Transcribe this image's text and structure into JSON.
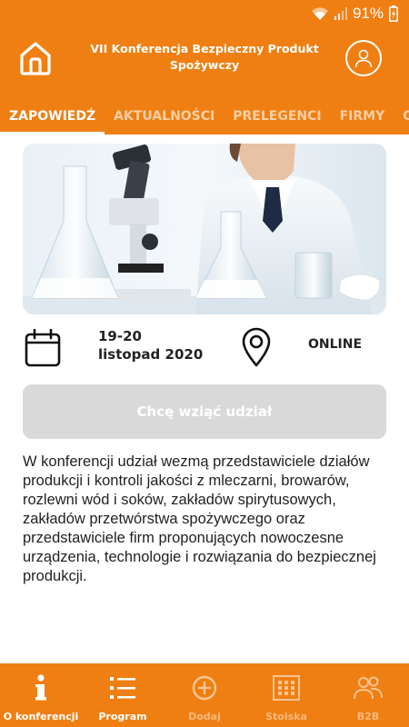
{
  "status_bar": {
    "battery": "91%"
  },
  "app_bar": {
    "title": "VII Konferencja Bezpieczny Produkt Spożywczy",
    "home_icon": "home-icon",
    "profile_icon": "user-icon"
  },
  "tabs": [
    {
      "label": "ZAPOWIEDŹ",
      "active": true
    },
    {
      "label": "AKTUALNOŚCI"
    },
    {
      "label": "PRELEGENCI"
    },
    {
      "label": "FIRMY"
    },
    {
      "label": "OFERTY"
    }
  ],
  "event": {
    "date_line1": "19-20",
    "date_line2": "listopad 2020",
    "location": "ONLINE"
  },
  "join_button": {
    "label": "Chcę wziąć udział",
    "enabled": false
  },
  "description": "W konferencji udział wezmą przedstawiciele działów produkcji i kontroli jakości z mleczarni, browarów, rozlewni wód i soków, zakładów spirytusowych, zakładów przetwórstwa spożywczego oraz przedstawiciele firm proponujących nowoczesne urządzenia, technologie i rozwiązania do bezpiecznej produkcji.",
  "bottom_nav": [
    {
      "label": "O konferencji",
      "icon": "info-icon",
      "enabled": true
    },
    {
      "label": "Program",
      "icon": "list-icon",
      "enabled": true
    },
    {
      "label": "Dodaj",
      "icon": "add-circle-icon",
      "enabled": false
    },
    {
      "label": "Stoiska",
      "icon": "grid-icon",
      "enabled": false
    },
    {
      "label": "B2B",
      "icon": "people-icon",
      "enabled": false
    }
  ],
  "colors": {
    "primary": "#ef7f12",
    "disabled_button": "#d9d9d9"
  }
}
